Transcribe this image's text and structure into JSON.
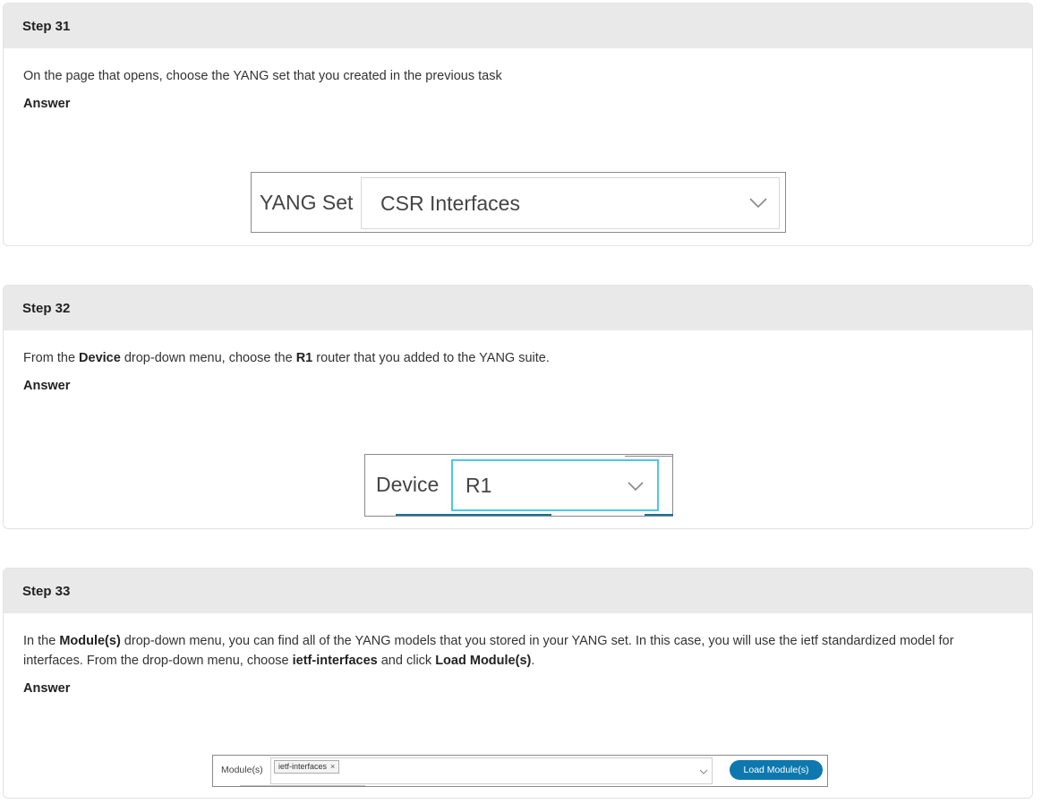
{
  "steps": [
    {
      "title": "Step 31",
      "instruction": "On the page that opens, choose the YANG set that you created in the previous task",
      "answer_label": "Answer",
      "widget": {
        "label": "YANG Set",
        "value": "CSR Interfaces"
      }
    },
    {
      "title": "Step 32",
      "instruction_parts": [
        "From the ",
        "Device",
        " drop-down menu, choose the ",
        "R1",
        " router that you added to the YANG suite."
      ],
      "answer_label": "Answer",
      "widget": {
        "label": "Device",
        "value": "R1"
      }
    },
    {
      "title": "Step 33",
      "instruction_parts": [
        "In the ",
        "Module(s)",
        " drop-down menu, you can find all of the YANG models that you stored in your YANG set. In this case, you will use the ietf standardized model for interfaces. From the drop-down menu, choose ",
        "ietf-interfaces",
        " and click ",
        "Load Module(s)",
        "."
      ],
      "answer_label": "Answer",
      "widget": {
        "label": "Module(s)",
        "tag": "ietf-interfaces",
        "tag_close": "×",
        "button": "Load Module(s)"
      }
    }
  ],
  "colors": {
    "header_bg": "#e9e9ea",
    "accent_blue": "#0e78ae",
    "focus_border": "#4fc6e6"
  },
  "icons": [
    "chevron-down-icon",
    "close-icon"
  ]
}
